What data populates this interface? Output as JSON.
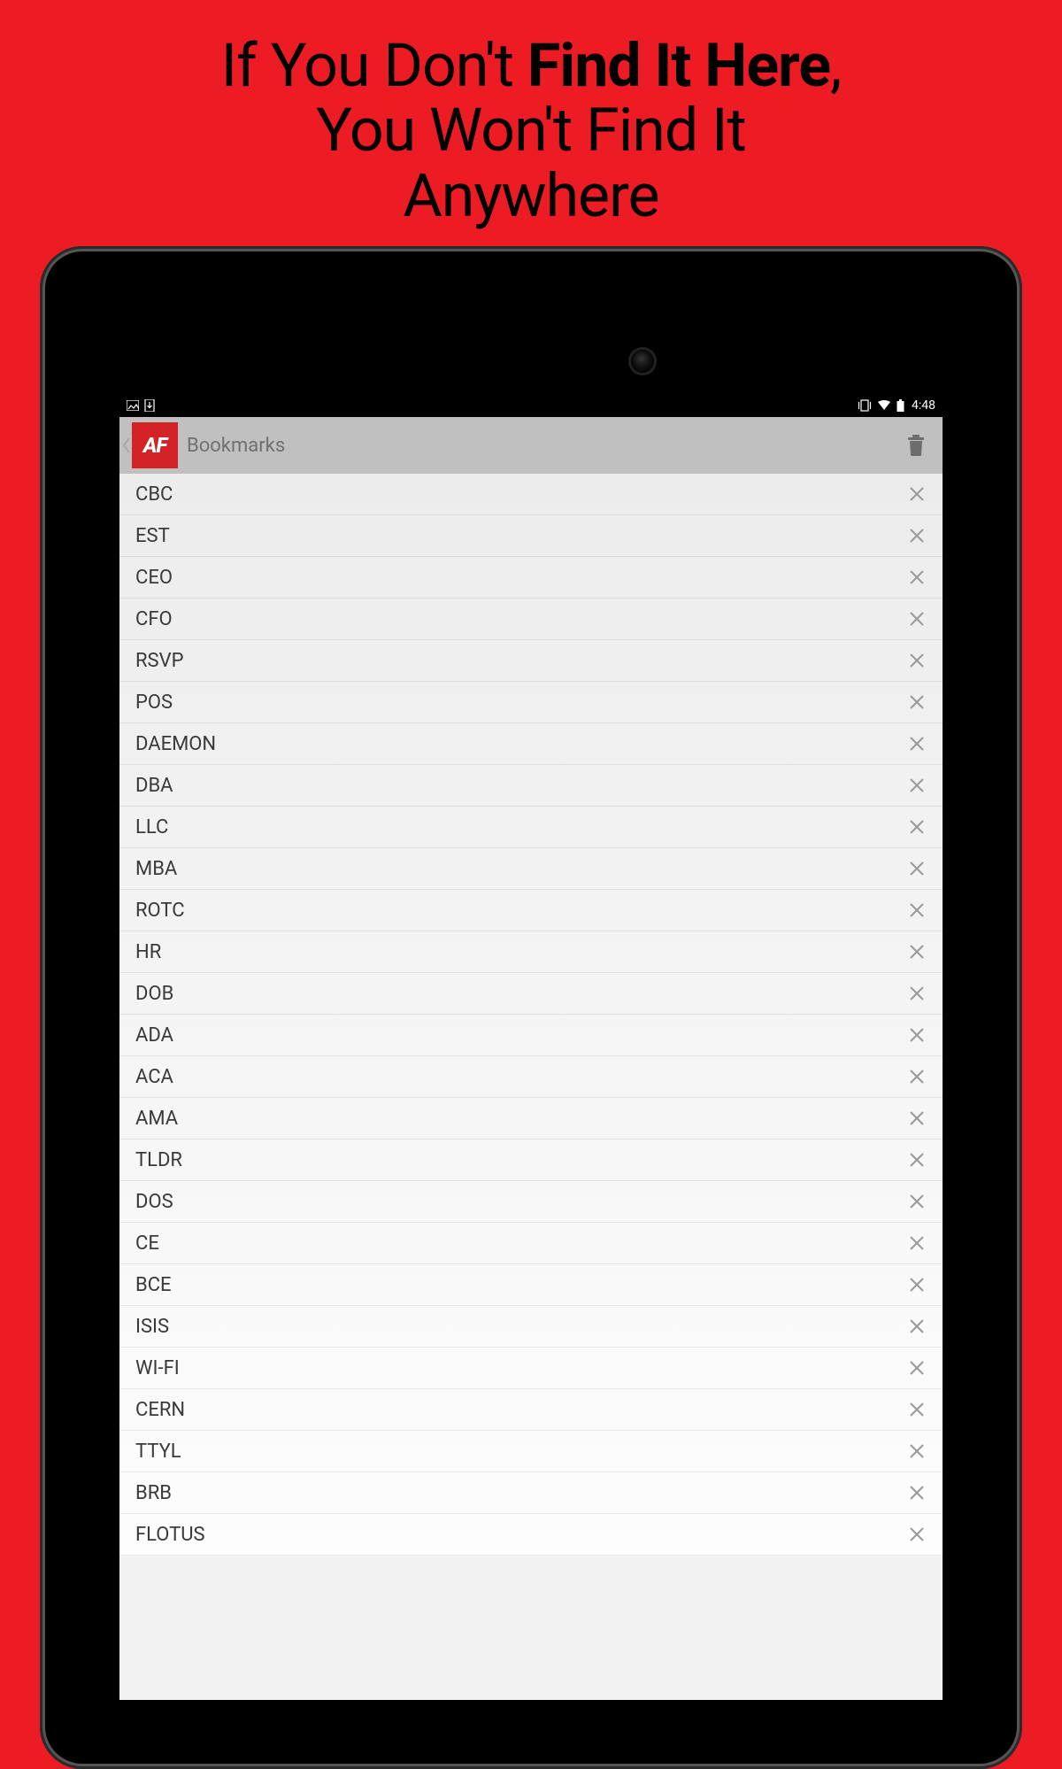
{
  "promo": {
    "line1_prefix": "If You Don't ",
    "line1_bold": "Find It Here",
    "line1_suffix": ",",
    "line2": "You Won't Find It",
    "line3": "Anywhere"
  },
  "status_bar": {
    "time": "4:48"
  },
  "header": {
    "logo_text": "AF",
    "title": "Bookmarks"
  },
  "bookmarks": [
    "CBC",
    "EST",
    "CEO",
    "CFO",
    "RSVP",
    "POS",
    "DAEMON",
    "DBA",
    "LLC",
    "MBA",
    "ROTC",
    "HR",
    "DOB",
    "ADA",
    "ACA",
    "AMA",
    "TLDR",
    "DOS",
    "CE",
    "BCE",
    "ISIS",
    "WI-FI",
    "CERN",
    "TTYL",
    "BRB",
    "FLOTUS"
  ]
}
